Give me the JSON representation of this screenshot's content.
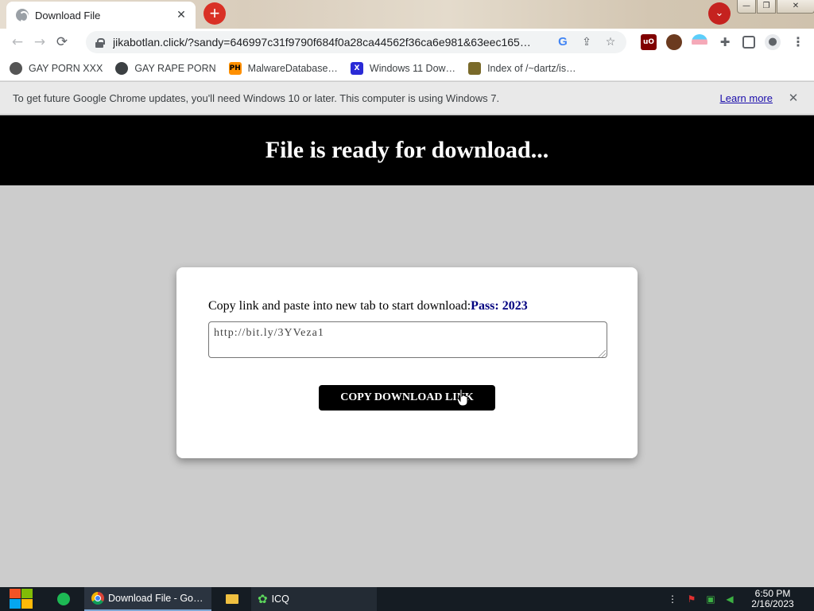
{
  "browser": {
    "tab_title": "Download File",
    "tab_close_glyph": "✕",
    "new_tab_glyph": "+",
    "tab_search_glyph": "⌄",
    "url": "jikabotlan.click/?sandy=646997c31f9790f684f0a28ca44562f36ca6e981&63eec165…",
    "window_controls": {
      "minimize": "—",
      "restore": "❐",
      "close": "✕"
    }
  },
  "bookmarks": [
    {
      "label": "GAY PORN XXX",
      "icon": "wolf-icon"
    },
    {
      "label": "GAY RAPE PORN",
      "icon": "globe-icon"
    },
    {
      "label": "MalwareDatabase…",
      "icon": "ph-icon",
      "icon_text": "PH"
    },
    {
      "label": "Windows 11 Dow…",
      "icon": "x-icon",
      "icon_text": "X"
    },
    {
      "label": "Index of /~dartz/is…",
      "icon": "tree-icon"
    }
  ],
  "infobar": {
    "message": "To get future Google Chrome updates, you'll need Windows 10 or later. This computer is using Windows 7.",
    "link": "Learn more"
  },
  "page": {
    "heading": "File is ready for download...",
    "instruction": "Copy link and paste into new tab to start download:",
    "password": "Pass: 2023",
    "link_value": "http://bit.ly/3YVeza1",
    "button_label": "COPY DOWNLOAD LINK"
  },
  "taskbar": {
    "chrome_label": "Download File - Go…",
    "icq_label": "ICQ",
    "time": "6:50 PM",
    "date": "2/16/2023"
  },
  "colors": {
    "page_background": "#cccccc",
    "header_background": "#000000",
    "password_color": "#000080",
    "button_background": "#000000"
  }
}
